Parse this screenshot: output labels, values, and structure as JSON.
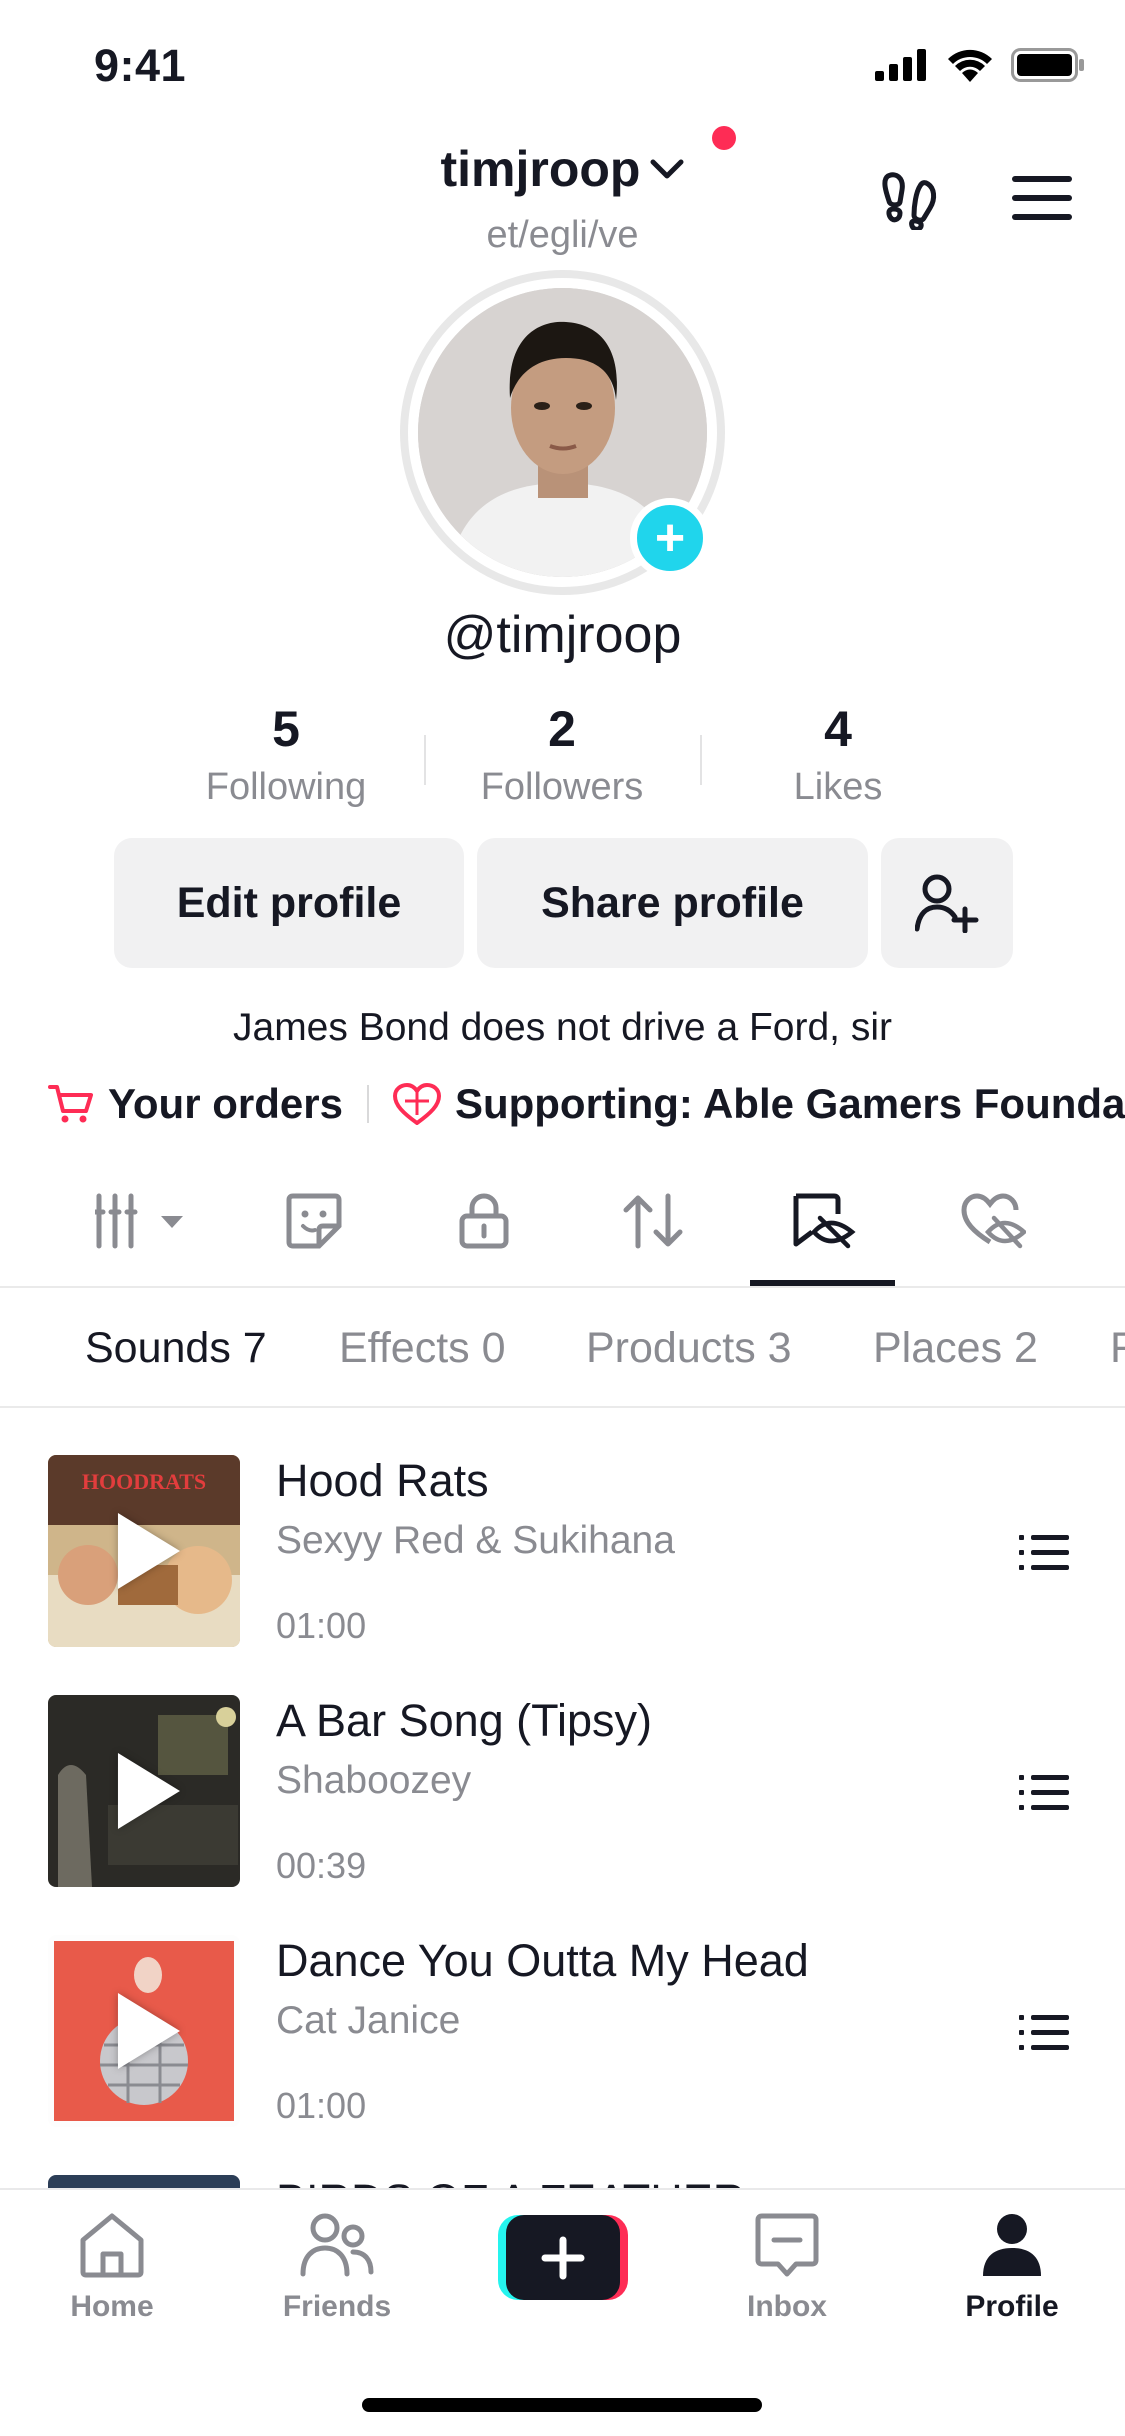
{
  "status_bar": {
    "time": "9:41"
  },
  "header": {
    "username": "timjroop",
    "pronouns": "et/egli/ve",
    "handle": "@timjroop"
  },
  "stats": [
    {
      "value": "5",
      "label": "Following"
    },
    {
      "value": "2",
      "label": "Followers"
    },
    {
      "value": "4",
      "label": "Likes"
    }
  ],
  "actions": {
    "edit": "Edit profile",
    "share": "Share profile"
  },
  "bio": "James Bond does not drive a Ford, sir",
  "links": {
    "orders": "Your orders",
    "supporting": "Supporting: Able Gamers Foundati"
  },
  "subtabs": [
    {
      "label": "Sounds 7",
      "active": true
    },
    {
      "label": "Effects 0",
      "active": false
    },
    {
      "label": "Products 3",
      "active": false
    },
    {
      "label": "Places 2",
      "active": false
    },
    {
      "label": "F",
      "active": false
    }
  ],
  "sounds": [
    {
      "title": "Hood Rats",
      "artist": "Sexyy Red & Sukihana",
      "duration": "01:00",
      "cover_color": "#b9a27a",
      "cover_text": "HOODRATS"
    },
    {
      "title": "A Bar Song (Tipsy)",
      "artist": "Shaboozey",
      "duration": "00:39",
      "cover_color": "#2b2a26"
    },
    {
      "title": "Dance You Outta My Head",
      "artist": "Cat Janice",
      "duration": "01:00",
      "cover_color": "#e85a4a"
    },
    {
      "title": "BIRDS OF A FEATHER",
      "artist": "",
      "duration": "",
      "cover_color": "#2c3e57"
    }
  ],
  "bottom_nav": [
    {
      "label": "Home",
      "icon": "home-icon"
    },
    {
      "label": "Friends",
      "icon": "friends-icon"
    },
    {
      "label": "",
      "icon": "create-icon"
    },
    {
      "label": "Inbox",
      "icon": "inbox-icon"
    },
    {
      "label": "Profile",
      "icon": "profile-icon"
    }
  ],
  "colors": {
    "accent_red": "#fe2c55",
    "accent_cyan": "#20d5ec",
    "text": "#161823",
    "muted": "#8a8b91"
  }
}
